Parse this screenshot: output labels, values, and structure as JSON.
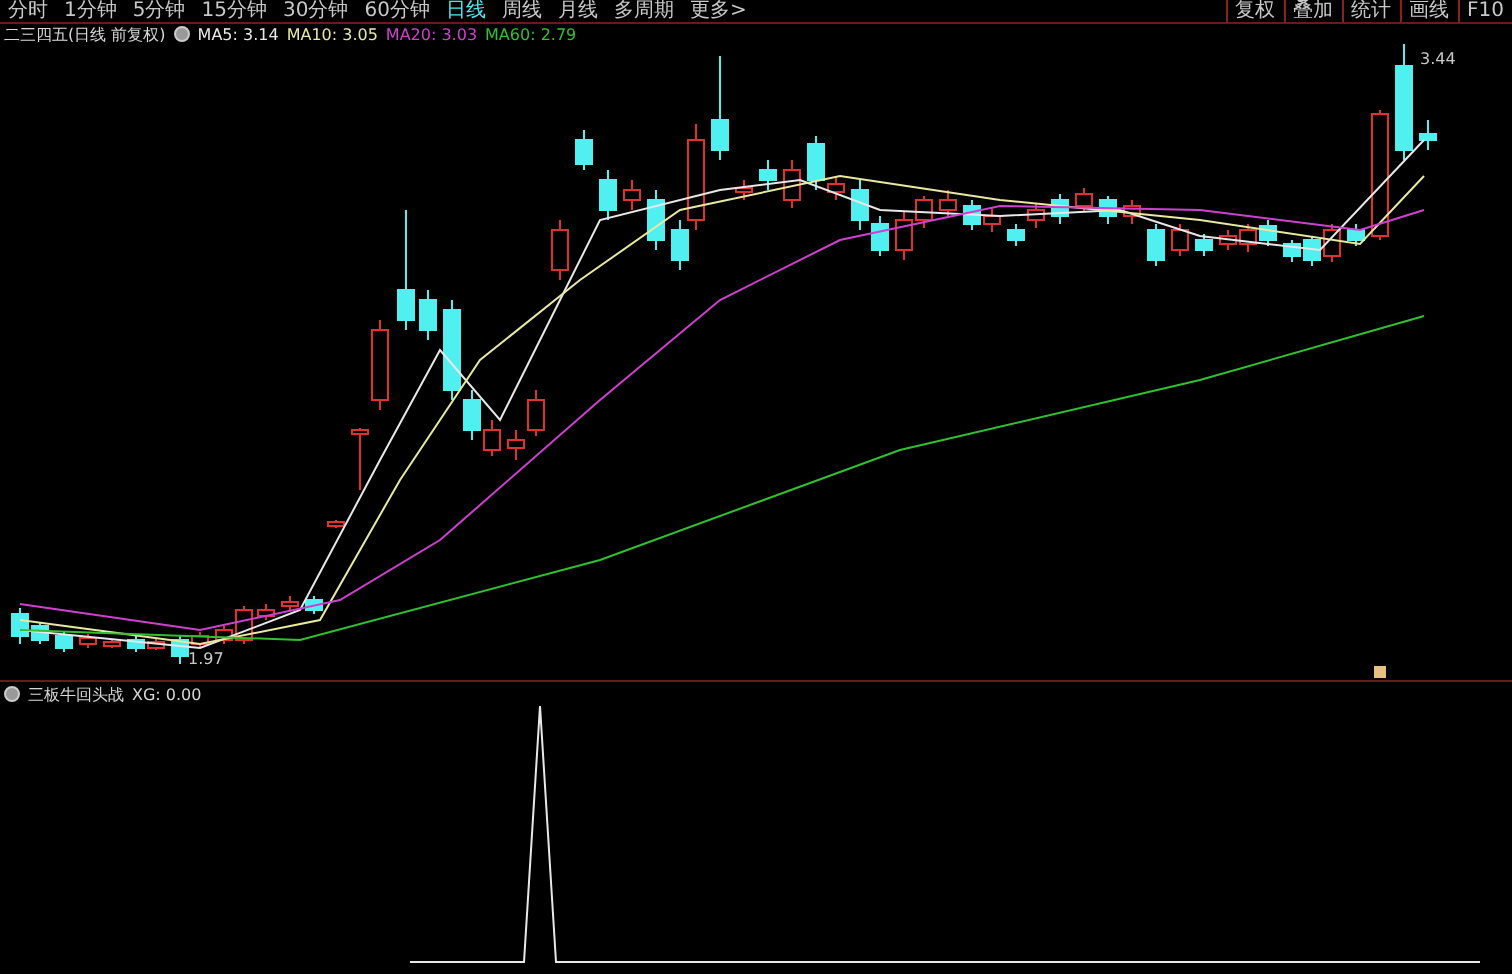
{
  "tabs": [
    {
      "label": "分时",
      "selected": false
    },
    {
      "label": "1分钟",
      "selected": false
    },
    {
      "label": "5分钟",
      "selected": false
    },
    {
      "label": "15分钟",
      "selected": false
    },
    {
      "label": "30分钟",
      "selected": false
    },
    {
      "label": "60分钟",
      "selected": false
    },
    {
      "label": "日线",
      "selected": true
    },
    {
      "label": "周线",
      "selected": false
    },
    {
      "label": "月线",
      "selected": false
    },
    {
      "label": "多周期",
      "selected": false
    },
    {
      "label": "更多>",
      "selected": false
    }
  ],
  "tools": [
    "复权",
    "叠加",
    "统计",
    "画线",
    "F10"
  ],
  "main_chart": {
    "title": "二三四五(日线 前复权)",
    "averages": [
      {
        "label": "MA5: 3.14",
        "color": "#e8e8e8"
      },
      {
        "label": "MA10: 3.05",
        "color": "#e8e8a0"
      },
      {
        "label": "MA20: 3.03",
        "color": "#d040d0"
      },
      {
        "label": "MA60: 2.79",
        "color": "#30c030"
      }
    ],
    "high_label": "3.44",
    "low_label": "1.97"
  },
  "indicator": {
    "title": "三板牛回头战",
    "reading": "XG: 0.00"
  }
}
